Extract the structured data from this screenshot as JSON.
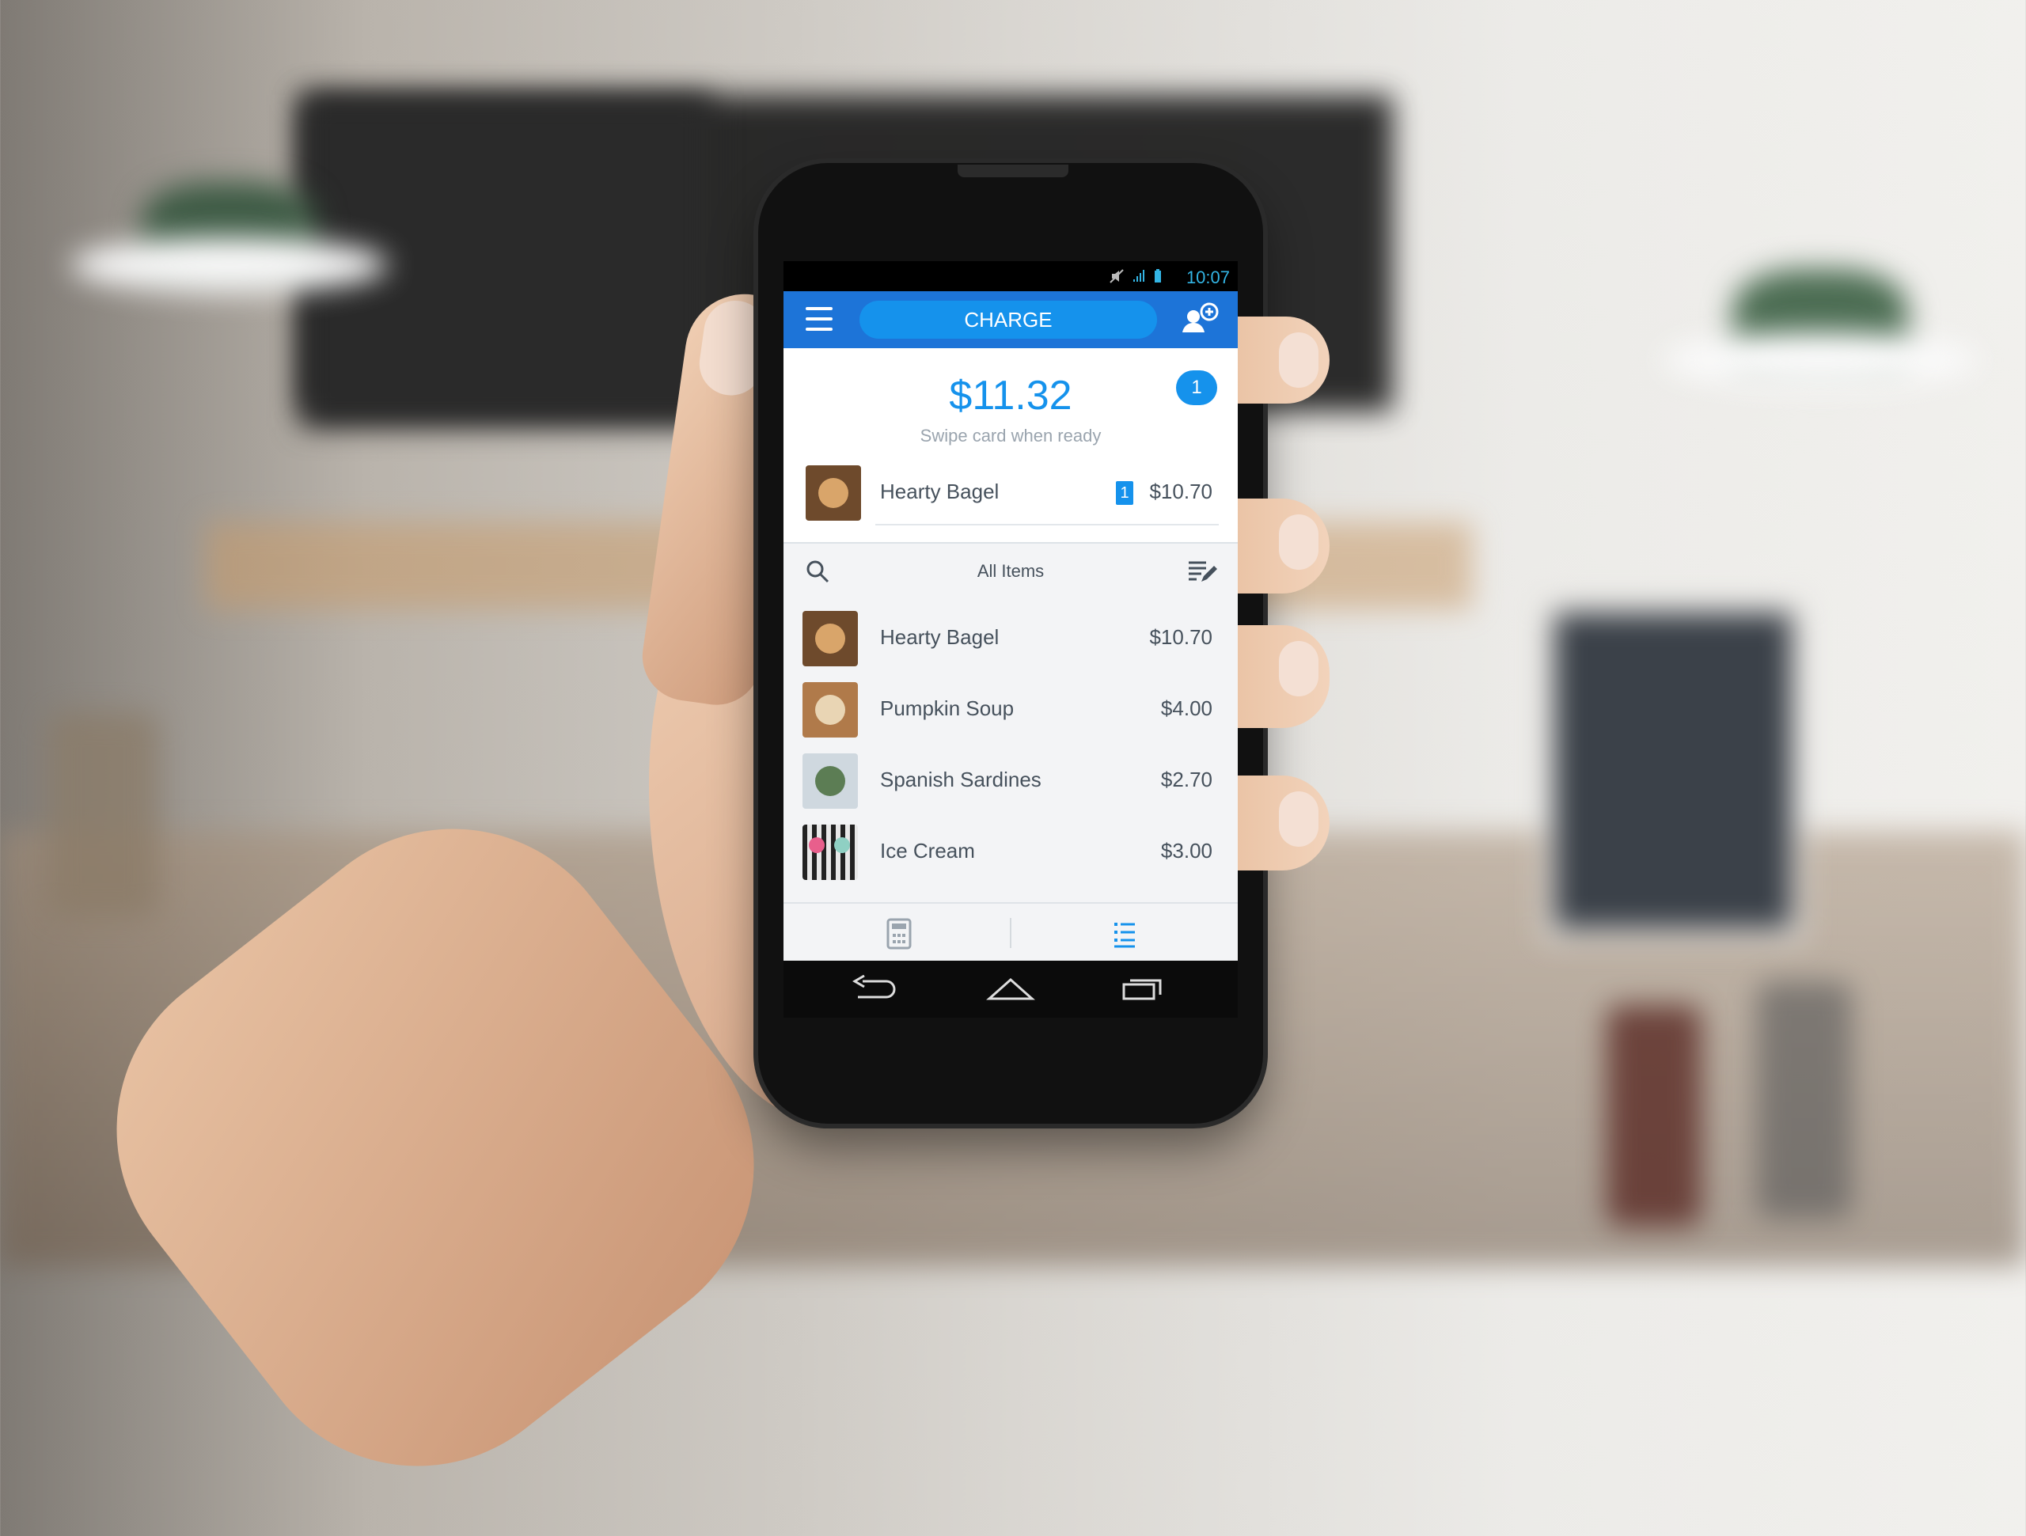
{
  "status_bar": {
    "time": "10:07"
  },
  "app_bar": {
    "charge_label": "CHARGE"
  },
  "summary": {
    "amount": "$11.32",
    "hint": "Swipe card when ready",
    "badge_count": "1",
    "order_items": [
      {
        "name": "Hearty Bagel",
        "qty": "1",
        "price": "$10.70"
      }
    ]
  },
  "library": {
    "title": "All Items",
    "items": [
      {
        "name": "Hearty Bagel",
        "price": "$10.70"
      },
      {
        "name": "Pumpkin Soup",
        "price": "$4.00"
      },
      {
        "name": "Spanish Sardines",
        "price": "$2.70"
      },
      {
        "name": "Ice Cream",
        "price": "$3.00"
      }
    ]
  },
  "colors": {
    "accent": "#1592ec",
    "app_bar": "#1d74d8",
    "text": "#46515c"
  },
  "icons": {
    "menu": "hamburger-icon",
    "customer": "add-customer-icon",
    "search": "search-icon",
    "edit": "edit-list-icon",
    "keypad": "calculator-icon",
    "library": "list-icon",
    "back": "back-icon",
    "home": "home-icon",
    "recents": "recents-icon"
  }
}
